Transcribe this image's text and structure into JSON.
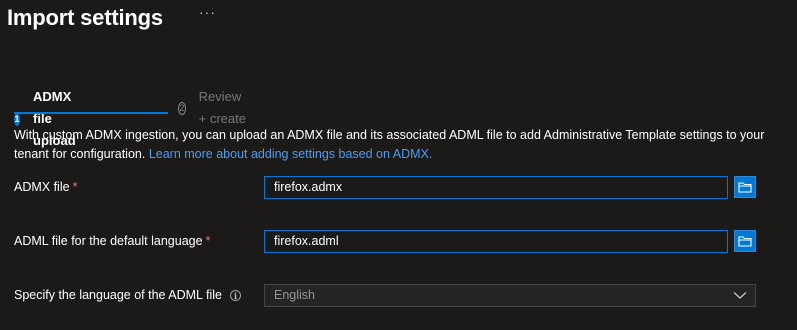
{
  "header": {
    "title": "Import settings",
    "more": "···"
  },
  "steps": [
    {
      "number": "1",
      "label": "ADMX file upload",
      "active": true
    },
    {
      "number": "2",
      "label": "Review + create",
      "active": false
    }
  ],
  "description": {
    "text": "With custom ADMX ingestion, you can upload an ADMX file and its associated ADML file to add Administrative Template settings to your tenant for configuration. ",
    "link": "Learn more about adding settings based on ADMX."
  },
  "form": {
    "admx": {
      "label": "ADMX file",
      "required": "*",
      "value": "firefox.admx"
    },
    "adml": {
      "label": "ADML file for the default language",
      "required": "*",
      "value": "firefox.adml"
    },
    "language": {
      "label": "Specify the language of the ADML file",
      "info": "i",
      "value": "English"
    }
  },
  "colors": {
    "accent": "#0078d4",
    "link": "#479ef5",
    "required": "#f1707b",
    "background": "#1b1a19"
  },
  "icons": {
    "browse": "folder-icon",
    "dropdown": "chevron-down-icon",
    "info": "info-icon"
  }
}
